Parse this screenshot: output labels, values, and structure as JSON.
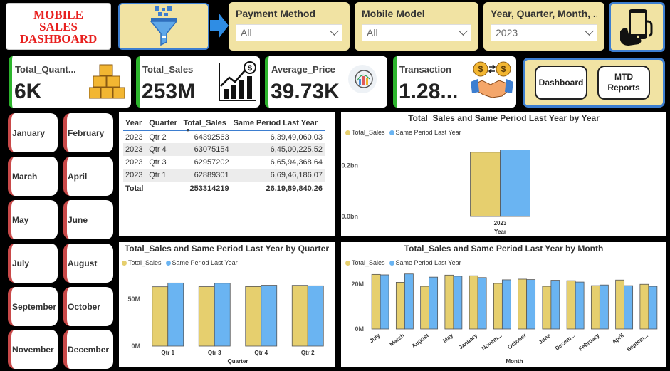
{
  "header": {
    "title_lines": [
      "MOBILE",
      "SALES",
      "DASHBOARD"
    ]
  },
  "slicers": [
    {
      "label": "Payment Method",
      "value": "All"
    },
    {
      "label": "Mobile Model",
      "value": "All"
    },
    {
      "label": "Year, Quarter, Month, ...",
      "value": "2023"
    }
  ],
  "icons": {
    "filter": "funnel-filter-icon",
    "arrow": "arrow-right-icon",
    "phone": "hand-holding-phone-icon",
    "quantity": "stacked-boxes-icon",
    "sales": "bar-chart-dollar-icon",
    "price": "chart-magnifier-icon",
    "transaction": "handshake-exchange-icon"
  },
  "kpis": [
    {
      "label": "Total_Quant...",
      "value": "6K"
    },
    {
      "label": "Total_Sales",
      "value": "253M"
    },
    {
      "label": "Average_Price",
      "value": "39.73K"
    },
    {
      "label": "Transaction",
      "value": "1.28..."
    }
  ],
  "nav": {
    "dashboard": "Dashboard",
    "mtd_line1": "MTD",
    "mtd_line2": "Reports"
  },
  "months": [
    "January",
    "February",
    "March",
    "April",
    "May",
    "June",
    "July",
    "August",
    "September",
    "October",
    "November",
    "December"
  ],
  "table": {
    "headers": [
      "Year",
      "Quarter",
      "Total_Sales",
      "Same Period Last Year"
    ],
    "rows": [
      [
        "2023",
        "Qtr 2",
        "64392563",
        "6,39,49,060.03"
      ],
      [
        "2023",
        "Qtr 4",
        "63075154",
        "6,45,00,225.52"
      ],
      [
        "2023",
        "Qtr 3",
        "62957202",
        "6,65,94,368.64"
      ],
      [
        "2023",
        "Qtr 1",
        "62889301",
        "6,69,46,186.07"
      ]
    ],
    "total": [
      "Total",
      "",
      "253314219",
      "26,19,89,840.26"
    ]
  },
  "colors": {
    "total_sales": "#e6cf6e",
    "same_period": "#6ab4f2",
    "accent_blue": "#3d7ed0",
    "kpi_green": "#2db52d",
    "month_red": "#c94949",
    "title_red": "#e8201f",
    "tan": "#f1e3a3"
  },
  "chart_data": [
    {
      "type": "bar",
      "title": "Total_Sales and Same Period Last Year by Year",
      "xlabel": "Year",
      "categories": [
        "2023"
      ],
      "y_ticks": [
        "0.0bn",
        "0.2bn"
      ],
      "ylim": [
        0,
        0.3
      ],
      "series": [
        {
          "name": "Total_Sales",
          "values": [
            0.253
          ]
        },
        {
          "name": "Same Period Last Year",
          "values": [
            0.262
          ]
        }
      ],
      "legend": "top-left"
    },
    {
      "type": "bar",
      "title": "Total_Sales and Same Period Last Year by Quarter",
      "xlabel": "Quarter",
      "categories": [
        "Qtr 1",
        "Qtr 3",
        "Qtr 4",
        "Qtr 2"
      ],
      "y_ticks": [
        "0M",
        "50M"
      ],
      "ylim": [
        0,
        80
      ],
      "series": [
        {
          "name": "Total_Sales",
          "values": [
            62.9,
            63.0,
            63.1,
            64.4
          ]
        },
        {
          "name": "Same Period Last Year",
          "values": [
            66.9,
            66.6,
            64.5,
            63.9
          ]
        }
      ],
      "legend": "top-left"
    },
    {
      "type": "bar",
      "title": "Total_Sales and Same Period Last Year by Month",
      "xlabel": "Month",
      "categories": [
        "July",
        "March",
        "August",
        "May",
        "January",
        "Novem...",
        "October",
        "June",
        "Decem...",
        "February",
        "April",
        "Septem..."
      ],
      "y_ticks": [
        "0M",
        "20M"
      ],
      "ylim": [
        0,
        26
      ],
      "series": [
        {
          "name": "Total_Sales",
          "values": [
            24.3,
            20.8,
            19.0,
            24.0,
            23.7,
            20.3,
            22.2,
            19.0,
            21.5,
            19.3,
            21.8,
            19.9
          ]
        },
        {
          "name": "Same Period Last Year",
          "values": [
            24.1,
            24.5,
            23.1,
            23.5,
            22.9,
            21.9,
            22.0,
            21.7,
            20.9,
            19.6,
            19.3,
            19.0
          ]
        }
      ],
      "legend": "top-left"
    }
  ]
}
